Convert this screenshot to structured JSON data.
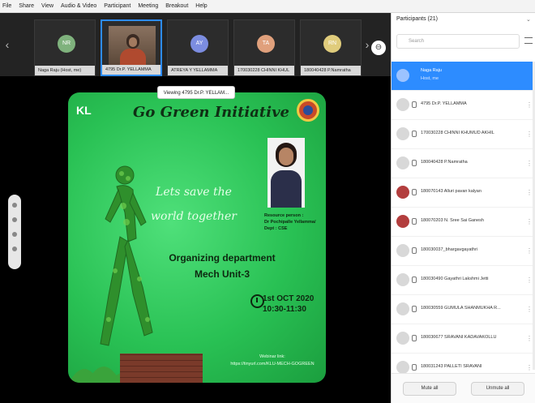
{
  "menubar": {
    "items": [
      "File",
      "Share",
      "View",
      "Audio & Video",
      "Participant",
      "Meeting",
      "Breakout",
      "Help"
    ]
  },
  "thumbnails": [
    {
      "initials": "NR",
      "label": "Naga Raju (Host, me)",
      "color": "#7fb27d"
    },
    {
      "label": "4795 Dr.P. YELLAMMA",
      "active": true
    },
    {
      "initials": "AY",
      "label": "ATREYA Y YELLAMMA",
      "color": "#7c8de0"
    },
    {
      "initials": "TA",
      "label": "170030228 CHINNI KHUL",
      "color": "#e0a07c"
    },
    {
      "initials": "RN",
      "label": "180040428 P.Namratha",
      "color": "#e0cc7c"
    }
  ],
  "slide": {
    "viewing_badge": "Viewing 4795 Dr.P. YELLAM...",
    "logo_prefix": "",
    "logo_text": "KL",
    "title": "Go Green Initiative",
    "tagline_line1": "Lets save the",
    "tagline_line2": "world together",
    "org_line1": "Organizing department",
    "org_line2": "Mech Unit-3",
    "date": "1st OCT 2020",
    "time": "10:30-11:30",
    "resource_label": "Resource person :",
    "resource_name": "Dr Pochipalle Yellamma/",
    "resource_dept": "Dept : CSE",
    "webinar_label": "Webinar link:",
    "webinar_link": "https://tinyurl.com/KLU-MECH-GOGREEN"
  },
  "panel": {
    "title": "Participants (21)",
    "search_placeholder": "Search",
    "participants": [
      {
        "name": "Naga Raju",
        "sub": "Host, me",
        "selected": true
      },
      {
        "name": "4795 Dr.P. YELLAMMA"
      },
      {
        "name": "170030228 CHINNI KHUMUD AKHIL"
      },
      {
        "name": "180040428 P.Namratha"
      },
      {
        "name": "180070143 Alluri pavan kalyan",
        "dark": true
      },
      {
        "name": "180070203 N. Sree Sai Ganesh",
        "dark": true
      },
      {
        "name": "180030037_bhargavgayathri"
      },
      {
        "name": "180030490 Gayathri Lakshmi Jetti"
      },
      {
        "name": "180030559 GUMULA SHANMUKHA R..."
      },
      {
        "name": "180030677 SRAVANI KADAVAKOLLU"
      },
      {
        "name": "180031243 PALLETI SRAVANI"
      }
    ],
    "mute_all": "Mute all",
    "unmute_all": "Unmute all"
  }
}
